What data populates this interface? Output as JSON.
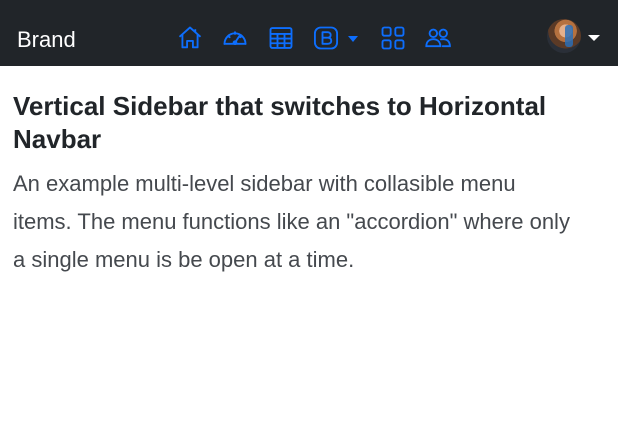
{
  "navbar": {
    "brand": "Brand",
    "icons": [
      "house-icon",
      "speedometer-icon",
      "table-icon",
      "bootstrap-icon",
      "grid-icon",
      "people-icon"
    ],
    "icon_color": "#0d6efd",
    "background": "#212529",
    "user_menu": {
      "avatar": "user-avatar"
    }
  },
  "main": {
    "title": "Vertical Sidebar that switches to Horizontal Navbar",
    "lead": "An example multi-level sidebar with collasible menu items. The menu functions like an \"accordion\" where only a single menu is be open at a time."
  }
}
